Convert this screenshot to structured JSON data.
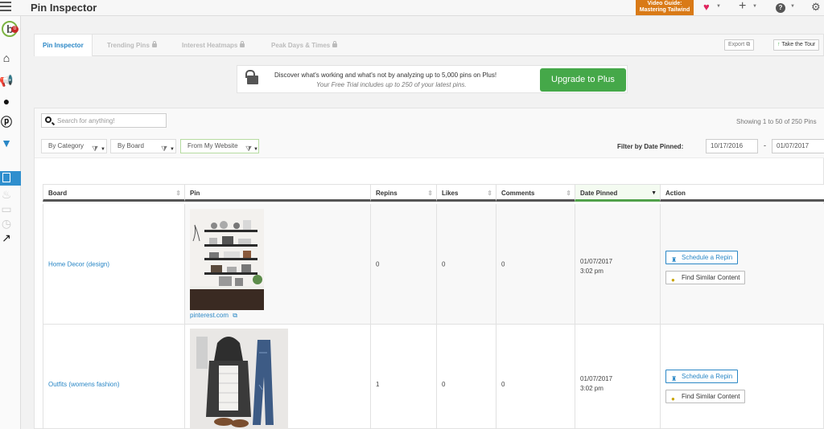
{
  "topbar": {
    "title": "Pin Inspector",
    "video_guide_line1": "Video Guide:",
    "video_guide_line2": "Mastering Tailwind"
  },
  "sidebar": {
    "logo_badge": "0"
  },
  "tabs": [
    {
      "label": "Pin Inspector",
      "active": true,
      "locked": false
    },
    {
      "label": "Trending Pins",
      "active": false,
      "locked": true
    },
    {
      "label": "Interest Heatmaps",
      "active": false,
      "locked": true
    },
    {
      "label": "Peak Days & Times",
      "active": false,
      "locked": true
    }
  ],
  "toolbar": {
    "export_label": "Export",
    "tour_label": "Take the Tour"
  },
  "promo": {
    "line1": "Discover what's working and what's not by analyzing up to 5,000 pins on Plus!",
    "line2": "Your Free Trial includes up to 250 of your latest pins.",
    "upgrade_label": "Upgrade to Plus"
  },
  "search": {
    "placeholder": "Search for anything!"
  },
  "showing_text": "Showing 1 to 50 of 250 Pins",
  "filters": {
    "category": "By Category",
    "board": "By Board",
    "website": "From My Website",
    "date_label": "Filter by Date Pinned:",
    "date_from": "10/17/2016",
    "date_sep": "-",
    "date_to": "01/07/2017"
  },
  "table": {
    "headers": [
      "Board",
      "Pin",
      "Repins",
      "Likes",
      "Comments",
      "Date Pinned",
      "Action"
    ],
    "rows": [
      {
        "board": "Home Decor (design)",
        "pin_link": "pinterest.com",
        "repins": "0",
        "likes": "0",
        "comments": "0",
        "date": "01/07/2017",
        "time": "3:02 pm",
        "schedule_label": "Schedule a Repin",
        "similar_label": "Find Similar Content"
      },
      {
        "board": "Outfits (womens fashion)",
        "pin_link": "",
        "repins": "1",
        "likes": "0",
        "comments": "0",
        "date": "01/07/2017",
        "time": "3:02 pm",
        "schedule_label": "Schedule a Repin",
        "similar_label": "Find Similar Content"
      }
    ]
  },
  "colors": {
    "accent_blue": "#2a87c6",
    "upgrade_green": "#45a849",
    "video_orange": "#d97a17",
    "sorted_green": "#51a14b"
  }
}
